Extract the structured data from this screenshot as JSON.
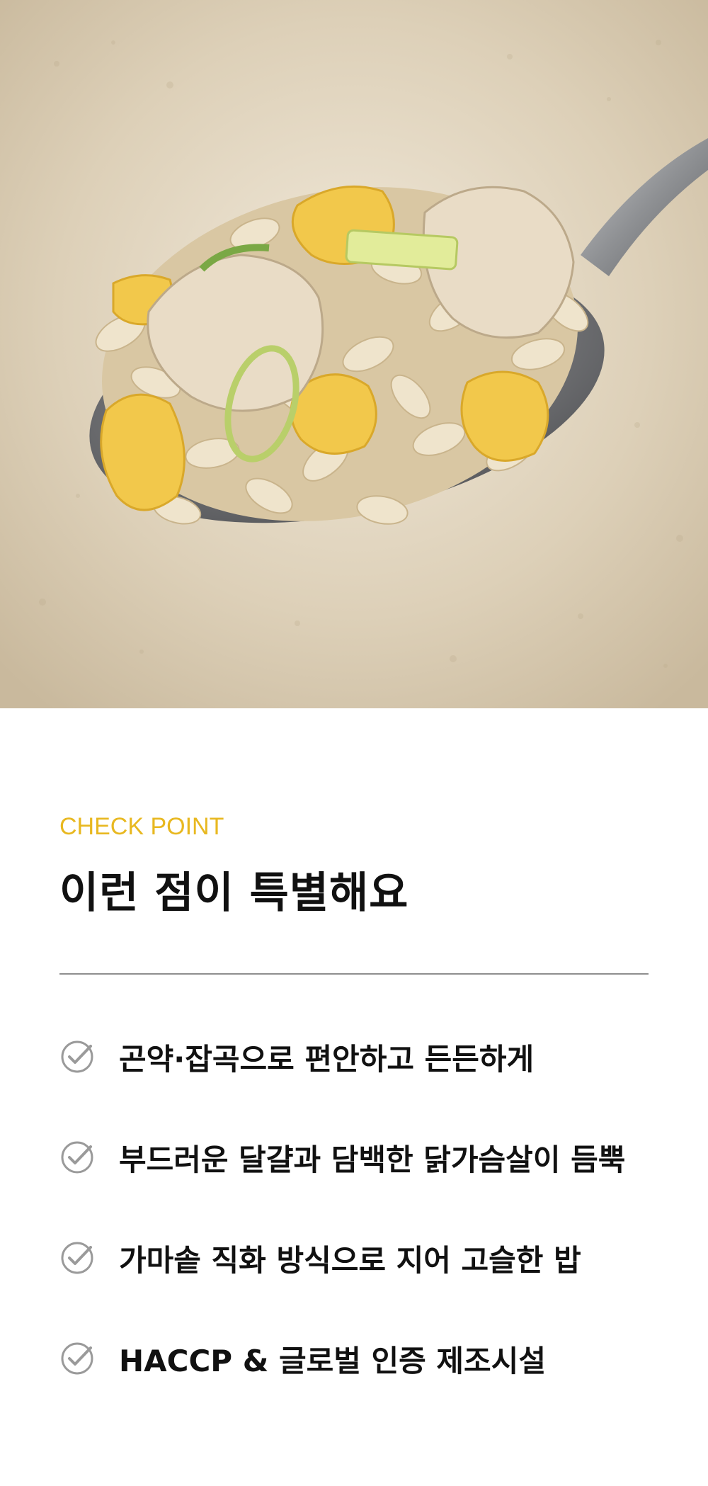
{
  "hero": {
    "image_description_icon": "rice-spoon-photo"
  },
  "section": {
    "eyebrow": "CHECK POINT",
    "title": "이런 점이 특별해요",
    "accent_color": "#e8b820"
  },
  "features": [
    {
      "text": "곤약·잡곡으로 편안하고 든든하게",
      "icon": "check-circle-icon"
    },
    {
      "text": "부드러운 달걀과 담백한 닭가슴살이 듬뿍",
      "icon": "check-circle-icon"
    },
    {
      "text": "가마솥 직화 방식으로 지어 고슬한 밥",
      "icon": "check-circle-icon"
    },
    {
      "text": "HACCP & 글로벌 인증 제조시설",
      "icon": "check-circle-icon"
    }
  ]
}
